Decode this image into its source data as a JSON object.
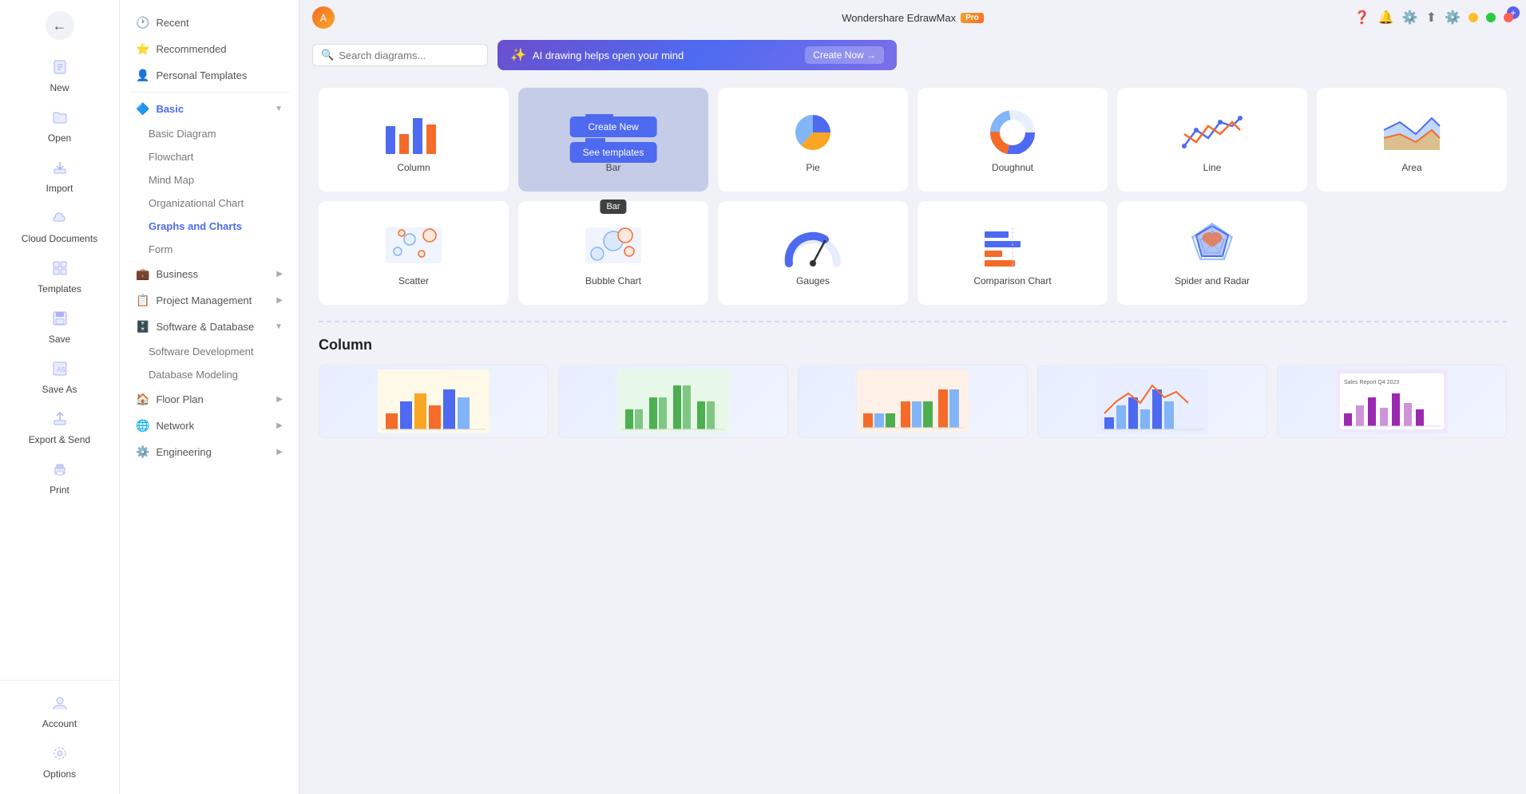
{
  "app": {
    "title": "Wondershare EdrawMax",
    "badge": "Pro"
  },
  "titlebar": {
    "minimize": "—",
    "maximize": "⬜",
    "close": "✕"
  },
  "toolbar": {
    "search_placeholder": "Search diagrams...",
    "ai_banner_text": "AI drawing helps open your mind",
    "create_now": "Create Now →"
  },
  "sidebar_narrow": {
    "items": [
      {
        "id": "new",
        "label": "New",
        "icon": "📄"
      },
      {
        "id": "open",
        "label": "Open",
        "icon": "📂"
      },
      {
        "id": "import",
        "label": "Import",
        "icon": "📥"
      },
      {
        "id": "cloud",
        "label": "Cloud Documents",
        "icon": "☁️"
      },
      {
        "id": "templates",
        "label": "Templates",
        "icon": "🗂️"
      },
      {
        "id": "save",
        "label": "Save",
        "icon": "💾"
      },
      {
        "id": "save-as",
        "label": "Save As",
        "icon": "💾"
      },
      {
        "id": "export",
        "label": "Export & Send",
        "icon": "📤"
      },
      {
        "id": "print",
        "label": "Print",
        "icon": "🖨️"
      }
    ],
    "bottom": [
      {
        "id": "account",
        "label": "Account",
        "icon": "👤"
      },
      {
        "id": "options",
        "label": "Options",
        "icon": "⚙️"
      }
    ]
  },
  "sidebar_wide": {
    "sections": [
      {
        "id": "recent",
        "label": "Recent",
        "icon": "🕐",
        "expandable": false
      },
      {
        "id": "recommended",
        "label": "Recommended",
        "icon": "⭐",
        "expandable": false
      },
      {
        "id": "personal",
        "label": "Personal Templates",
        "icon": "👤",
        "expandable": false
      }
    ],
    "categories": [
      {
        "id": "basic",
        "label": "Basic",
        "icon": "🔷",
        "active": true,
        "expanded": true,
        "children": [
          {
            "id": "basic-diagram",
            "label": "Basic Diagram"
          },
          {
            "id": "flowchart",
            "label": "Flowchart"
          },
          {
            "id": "mind-map",
            "label": "Mind Map"
          },
          {
            "id": "org-chart",
            "label": "Organizational Chart"
          },
          {
            "id": "graphs-charts",
            "label": "Graphs and Charts",
            "active": true
          },
          {
            "id": "form",
            "label": "Form"
          }
        ]
      },
      {
        "id": "business",
        "label": "Business",
        "icon": "💼",
        "expandable": true
      },
      {
        "id": "project-mgmt",
        "label": "Project Management",
        "icon": "📋",
        "expandable": true
      },
      {
        "id": "software-db",
        "label": "Software & Database",
        "icon": "🗄️",
        "expanded": true,
        "children": [
          {
            "id": "sw-dev",
            "label": "Software Development"
          },
          {
            "id": "db-modeling",
            "label": "Database Modeling"
          }
        ]
      },
      {
        "id": "floor-plan",
        "label": "Floor Plan",
        "icon": "🏠",
        "expandable": true
      },
      {
        "id": "network",
        "label": "Network",
        "icon": "🌐",
        "expandable": true
      },
      {
        "id": "engineering",
        "label": "Engineering",
        "icon": "⚙️",
        "expandable": true
      }
    ]
  },
  "chart_types": [
    {
      "id": "column",
      "label": "Column",
      "selected": false,
      "tooltip": null
    },
    {
      "id": "bar",
      "label": "Bar",
      "selected": true,
      "tooltip": "Bar"
    },
    {
      "id": "pie",
      "label": "Pie",
      "selected": false,
      "tooltip": null
    },
    {
      "id": "doughnut",
      "label": "Doughnut",
      "selected": false,
      "tooltip": null
    },
    {
      "id": "line",
      "label": "Line",
      "selected": false,
      "tooltip": null
    },
    {
      "id": "area",
      "label": "Area",
      "selected": false,
      "tooltip": null
    },
    {
      "id": "scatter",
      "label": "Scatter",
      "selected": false,
      "tooltip": null
    },
    {
      "id": "bubble",
      "label": "Bubble Chart",
      "selected": false,
      "tooltip": null
    },
    {
      "id": "gauges",
      "label": "Gauges",
      "selected": false,
      "tooltip": null
    },
    {
      "id": "comparison",
      "label": "Comparison Chart",
      "selected": false,
      "tooltip": null
    },
    {
      "id": "spider",
      "label": "Spider and Radar",
      "selected": false,
      "tooltip": null
    }
  ],
  "hover_btns": {
    "create_new": "Create New",
    "see_templates": "See templates"
  },
  "section": {
    "title": "Column"
  },
  "top_icons": [
    {
      "id": "help",
      "icon": "❓"
    },
    {
      "id": "bell",
      "icon": "🔔"
    },
    {
      "id": "settings",
      "icon": "⚙️"
    },
    {
      "id": "share",
      "icon": "↑"
    },
    {
      "id": "prefs",
      "icon": "⚙️"
    }
  ]
}
